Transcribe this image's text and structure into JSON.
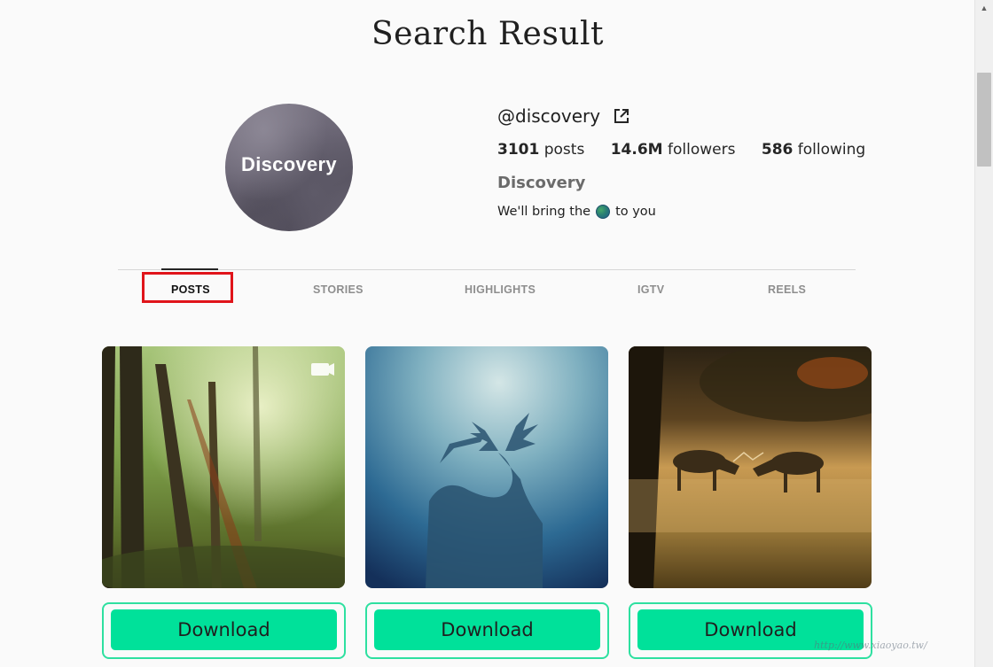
{
  "page": {
    "title": "Search Result"
  },
  "profile": {
    "avatar_brand": "Discovery",
    "username": "@discovery",
    "stats": {
      "posts_count": "3101",
      "posts_label": "posts",
      "followers_count": "14.6M",
      "followers_label": "followers",
      "following_count": "586",
      "following_label": "following"
    },
    "full_name": "Discovery",
    "bio_before": "We'll bring the",
    "bio_emoji": "globe-icon",
    "bio_after": "to you"
  },
  "tabs": [
    {
      "label": "POSTS",
      "active": true
    },
    {
      "label": "STORIES",
      "active": false
    },
    {
      "label": "HIGHLIGHTS",
      "active": false
    },
    {
      "label": "IGTV",
      "active": false
    },
    {
      "label": "REELS",
      "active": false
    }
  ],
  "posts": [
    {
      "image": "forest-sunlight-photo",
      "video_badge": "video-icon",
      "download_label": "Download"
    },
    {
      "image": "stag-silhouette-photo",
      "download_label": "Download"
    },
    {
      "image": "deer-fighting-photo",
      "download_label": "Download"
    }
  ],
  "watermark": {
    "text": "http://www.xiaoyao.tw/"
  },
  "colors": {
    "accent_green": "#00e19a",
    "button_border": "#2ee0a0",
    "highlight_red": "#e0141a",
    "background": "#fafafa"
  }
}
